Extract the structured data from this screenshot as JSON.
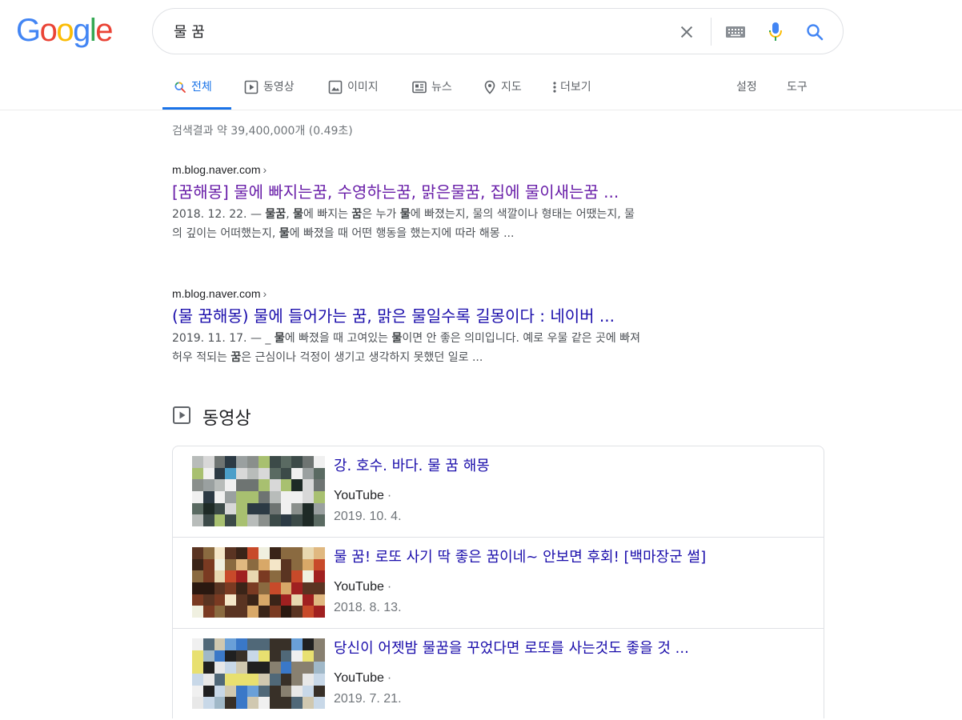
{
  "logo": {
    "letters": [
      "G",
      "o",
      "o",
      "g",
      "l",
      "e"
    ],
    "colors": [
      "#4285F4",
      "#EA4335",
      "#FBBC05",
      "#4285F4",
      "#34A853",
      "#EA4335"
    ]
  },
  "search": {
    "query": "물 꿈",
    "clear_icon": "close-icon",
    "keyboard_icon": "keyboard-icon",
    "mic_icon": "mic-icon",
    "search_icon": "search-icon"
  },
  "tabs": [
    {
      "label": "전체",
      "icon": "search-icon",
      "active": true
    },
    {
      "label": "동영상",
      "icon": "play-icon"
    },
    {
      "label": "이미지",
      "icon": "image-icon"
    },
    {
      "label": "뉴스",
      "icon": "news-icon"
    },
    {
      "label": "지도",
      "icon": "map-pin-icon"
    },
    {
      "label": "더보기",
      "icon": "more-vert-icon"
    }
  ],
  "tools": {
    "settings": "설정",
    "tools": "도구"
  },
  "stats": "검색결과 약 39,400,000개 (0.49초)",
  "results": [
    {
      "cite": "m.blog.naver.com",
      "title": "[꿈해몽] 물에 빠지는꿈, 수영하는꿈, 맑은물꿈, 집에 물이새는꿈 ...",
      "visited": true,
      "snippet_parts": [
        [
          "2018. 12. 22. — ",
          false
        ],
        [
          "물꿈",
          true
        ],
        [
          ", ",
          false
        ],
        [
          "물",
          true
        ],
        [
          "에 빠지는 ",
          false
        ],
        [
          "꿈",
          true
        ],
        [
          "은 누가 ",
          false
        ],
        [
          "물",
          true
        ],
        [
          "에 빠졌는지, 물의 색깔이나 형태는 어땠는지, 물",
          false
        ],
        [
          "\n",
          false
        ],
        [
          "의 깊이는 어떠했는지, ",
          false
        ],
        [
          "물",
          true
        ],
        [
          "에 빠졌을 때 어떤 행동을 했는지에 따라 해몽 ...",
          false
        ]
      ]
    },
    {
      "cite": "m.blog.naver.com",
      "title": "(물 꿈해몽) 물에 들어가는 꿈, 맑은 물일수록 길몽이다 : 네이버 ...",
      "visited": false,
      "snippet_parts": [
        [
          "2019. 11. 17. — _ ",
          false
        ],
        [
          "물",
          true
        ],
        [
          "에 빠졌을 때 고여있는 ",
          false
        ],
        [
          "물",
          true
        ],
        [
          "이면 안 좋은 의미입니다. 예로 우물 같은 곳에 빠져",
          false
        ],
        [
          "\n",
          false
        ],
        [
          "허우 적되는 ",
          false
        ],
        [
          "꿈",
          true
        ],
        [
          "은 근심이나 걱정이 생기고 생각하지 못했던 일로 ...",
          false
        ]
      ]
    }
  ],
  "videos": {
    "heading": "동영상",
    "items": [
      {
        "title": "강. 호수. 바다. 물 꿈 해몽",
        "source": "YouTube",
        "date": "2019. 10. 4."
      },
      {
        "title": "물 꿈! 로또 사기 딱 좋은 꿈이네~ 안보면 후회! [백마장군 썰]",
        "source": "YouTube",
        "date": "2018. 8. 13."
      },
      {
        "title": "당신이 어젯밤 물꿈을 꾸었다면 로또를 사는것도 좋을 것 ...",
        "source": "YouTube",
        "date": "2019. 7. 21."
      }
    ]
  },
  "colors": {
    "link": "#1a0dab",
    "visited": "#681da8",
    "accent": "#1a73e8"
  }
}
